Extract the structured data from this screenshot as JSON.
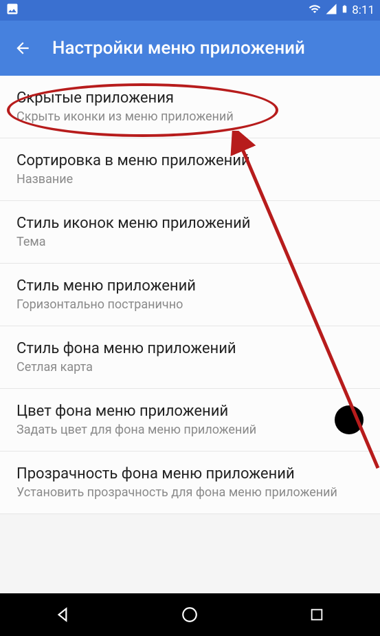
{
  "statusbar": {
    "time": "8:11"
  },
  "header": {
    "title": "Настройки меню приложений"
  },
  "items": [
    {
      "title": "Скрытые приложения",
      "subtitle": "Скрыть иконки из меню приложений"
    },
    {
      "title": "Сортировка в меню приложений",
      "subtitle": "Название"
    },
    {
      "title": "Стиль иконок меню приложений",
      "subtitle": "Тема"
    },
    {
      "title": "Стиль меню приложений",
      "subtitle": "Горизонтально постранично"
    },
    {
      "title": "Стиль фона меню приложений",
      "subtitle": "Сетлая карта"
    },
    {
      "title": "Цвет фона меню приложений",
      "subtitle": "Задать цвет для фона меню приложений",
      "swatch": "#000000"
    },
    {
      "title": "Прозрачность фона меню приложений",
      "subtitle": "Установить прозрачность для фона меню приложений"
    }
  ]
}
